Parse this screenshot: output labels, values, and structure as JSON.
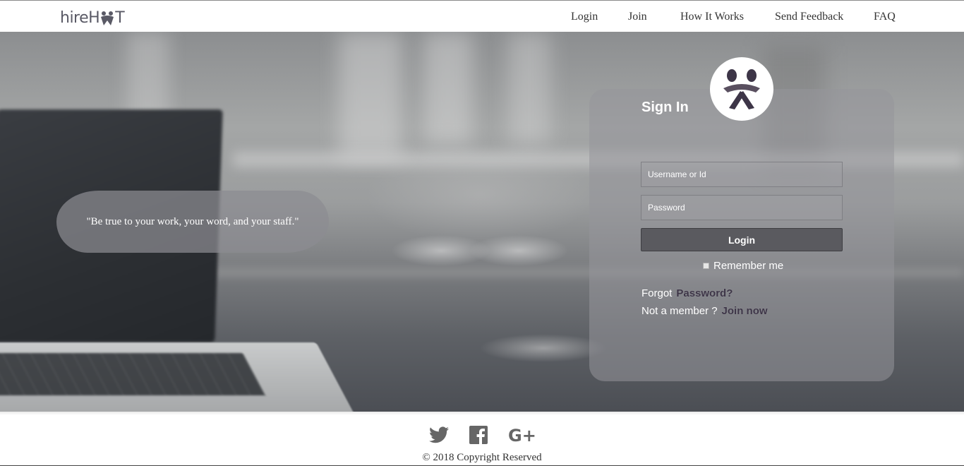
{
  "header": {
    "logo_text": "hireH",
    "logo_suffix": "T",
    "nav": {
      "login": "Login",
      "join": "Join",
      "how_it_works": "How It Works",
      "send_feedback": "Send Feedback",
      "faq": "FAQ"
    }
  },
  "hero": {
    "quote": "\"Be true to your work, your word, and your staff.\""
  },
  "signin": {
    "title": "Sign In",
    "username_placeholder": "Username or Id",
    "password_placeholder": "Password",
    "login_button": "Login",
    "remember_me": "Remember me",
    "forgot_prefix": "Forgot",
    "forgot_link": "Password?",
    "member_prefix": "Not a member ?",
    "join_link": "Join now"
  },
  "footer": {
    "social_icons": [
      "twitter-icon",
      "facebook-icon",
      "google-plus-icon"
    ],
    "copyright": "© 2018 Copyright Reserved"
  },
  "colors": {
    "accent_dark": "#3d3547",
    "button_bg": "#5a5a5f"
  }
}
